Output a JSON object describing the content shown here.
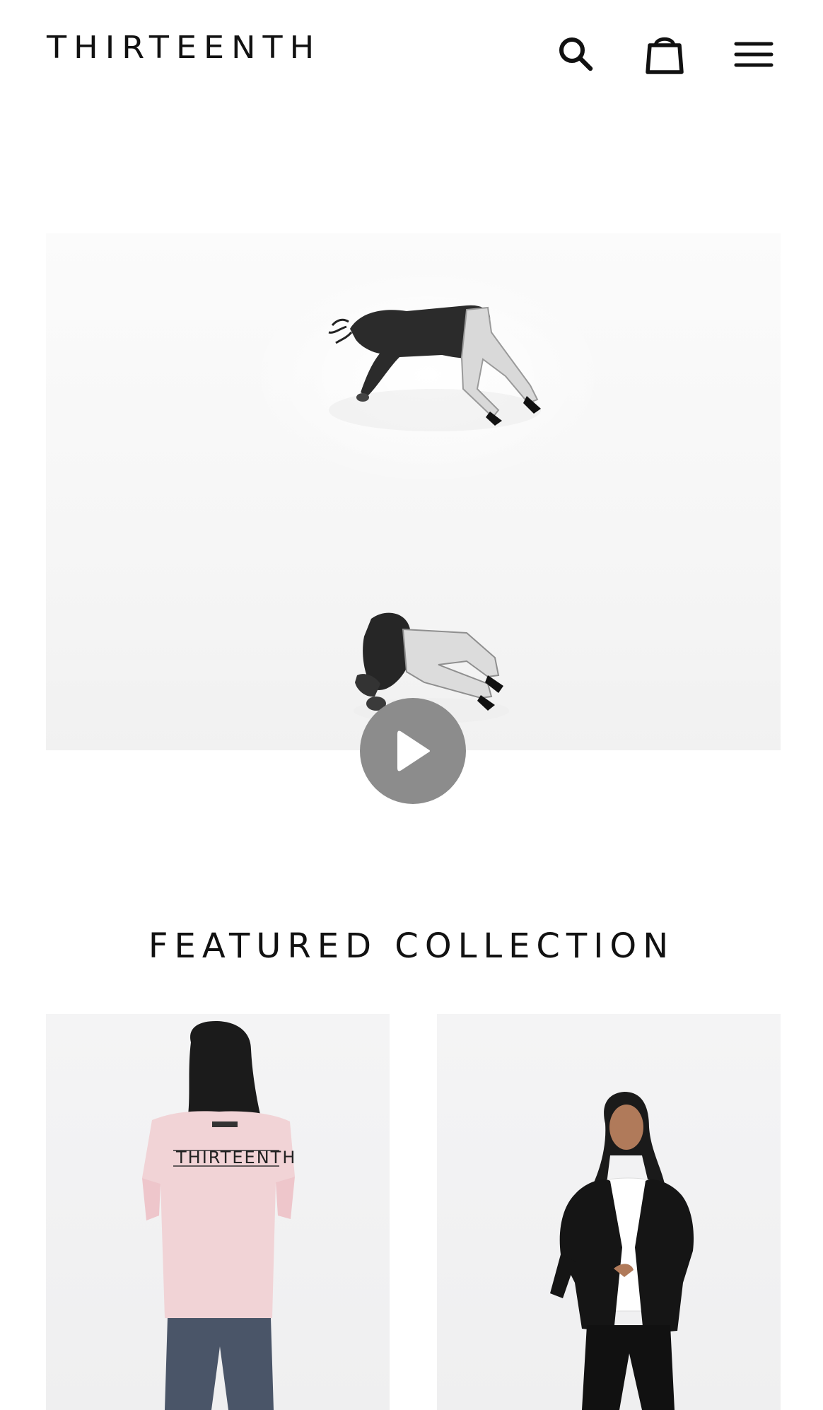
{
  "header": {
    "logo_text": "THIRTEENTH",
    "icons": {
      "search": "search-icon",
      "cart": "shopping-bag-icon",
      "menu": "hamburger-menu-icon"
    }
  },
  "hero": {
    "media_type": "video",
    "play_icon": "play-icon"
  },
  "featured": {
    "title": "FEATURED COLLECTION",
    "products": [
      {
        "image_print": "THIRTEENTH"
      },
      {
        "image_print": ""
      }
    ]
  },
  "colors": {
    "text": "#111111",
    "background": "#ffffff",
    "play_button": "#8c8c8c",
    "tee_pink": "#f1d3d6"
  }
}
